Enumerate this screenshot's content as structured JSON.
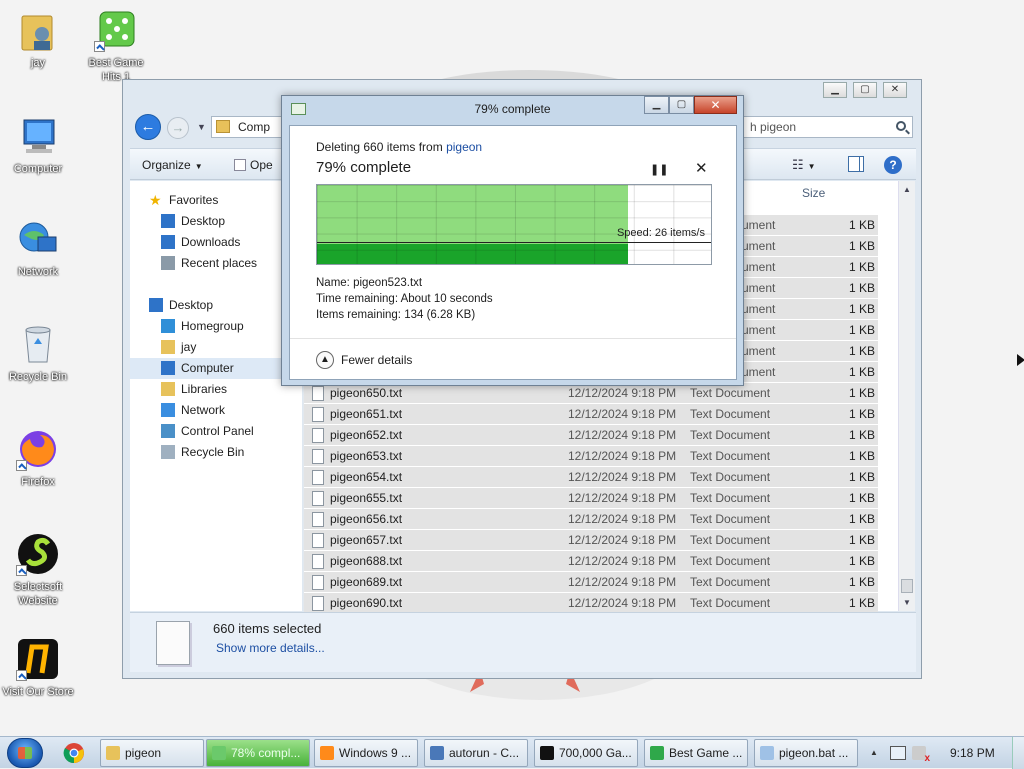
{
  "desktop": {
    "icons": [
      {
        "label": "jay",
        "icon": "user-folder-icon"
      },
      {
        "label": "Best Game Hits 1",
        "icon": "dice-icon"
      },
      {
        "label": "Computer",
        "icon": "computer-icon"
      },
      {
        "label": "Network",
        "icon": "network-icon"
      },
      {
        "label": "Recycle Bin",
        "icon": "recycle-bin-icon"
      },
      {
        "label": "Firefox",
        "icon": "firefox-icon"
      },
      {
        "label": "Selectsoft Website",
        "icon": "selectsoft-icon"
      },
      {
        "label": "Visit Our Store",
        "icon": "store-icon"
      }
    ]
  },
  "explorer": {
    "address_crumb": "Comp",
    "search_placeholder": "h pigeon",
    "toolbar": {
      "organize": "Organize",
      "open": "Ope"
    },
    "nav": [
      {
        "label": "Favorites",
        "icon": "star-icon",
        "level": 0
      },
      {
        "label": "Desktop",
        "icon": "desktop-icon",
        "level": 1
      },
      {
        "label": "Downloads",
        "icon": "downloads-icon",
        "level": 1
      },
      {
        "label": "Recent places",
        "icon": "recent-places-icon",
        "level": 1
      },
      {
        "label": "Desktop",
        "icon": "desktop-icon",
        "level": 0
      },
      {
        "label": "Homegroup",
        "icon": "homegroup-icon",
        "level": 1
      },
      {
        "label": "jay",
        "icon": "user-folder-icon",
        "level": 1
      },
      {
        "label": "Computer",
        "icon": "computer-icon",
        "level": 1,
        "selected": true
      },
      {
        "label": "Libraries",
        "icon": "libraries-icon",
        "level": 1
      },
      {
        "label": "Network",
        "icon": "network-icon",
        "level": 1
      },
      {
        "label": "Control Panel",
        "icon": "control-panel-icon",
        "level": 1
      },
      {
        "label": "Recycle Bin",
        "icon": "recycle-bin-icon",
        "level": 1
      }
    ],
    "columns": {
      "size": "Size"
    },
    "partial_rows": [
      {
        "type": "ument",
        "size": "1 KB"
      },
      {
        "type": "ument",
        "size": "1 KB"
      },
      {
        "type": "ument",
        "size": "1 KB"
      },
      {
        "type": "ument",
        "size": "1 KB"
      },
      {
        "type": "ument",
        "size": "1 KB"
      },
      {
        "type": "ument",
        "size": "1 KB"
      },
      {
        "type": "ument",
        "size": "1 KB"
      },
      {
        "type": "ument",
        "size": "1 KB"
      }
    ],
    "rows": [
      {
        "name": "pigeon650.txt",
        "date": "12/12/2024 9:18 PM",
        "type": "Text Document",
        "size": "1 KB"
      },
      {
        "name": "pigeon651.txt",
        "date": "12/12/2024 9:18 PM",
        "type": "Text Document",
        "size": "1 KB"
      },
      {
        "name": "pigeon652.txt",
        "date": "12/12/2024 9:18 PM",
        "type": "Text Document",
        "size": "1 KB"
      },
      {
        "name": "pigeon653.txt",
        "date": "12/12/2024 9:18 PM",
        "type": "Text Document",
        "size": "1 KB"
      },
      {
        "name": "pigeon654.txt",
        "date": "12/12/2024 9:18 PM",
        "type": "Text Document",
        "size": "1 KB"
      },
      {
        "name": "pigeon655.txt",
        "date": "12/12/2024 9:18 PM",
        "type": "Text Document",
        "size": "1 KB"
      },
      {
        "name": "pigeon656.txt",
        "date": "12/12/2024 9:18 PM",
        "type": "Text Document",
        "size": "1 KB"
      },
      {
        "name": "pigeon657.txt",
        "date": "12/12/2024 9:18 PM",
        "type": "Text Document",
        "size": "1 KB"
      },
      {
        "name": "pigeon688.txt",
        "date": "12/12/2024 9:18 PM",
        "type": "Text Document",
        "size": "1 KB"
      },
      {
        "name": "pigeon689.txt",
        "date": "12/12/2024 9:18 PM",
        "type": "Text Document",
        "size": "1 KB"
      },
      {
        "name": "pigeon690.txt",
        "date": "12/12/2024 9:18 PM",
        "type": "Text Document",
        "size": "1 KB"
      }
    ],
    "details": {
      "selected": "660 items selected",
      "more": "Show more details..."
    }
  },
  "dialog": {
    "title": "79% complete",
    "deleting_prefix": "Deleting 660 items from ",
    "source_folder": "pigeon",
    "percent_text": "79% complete",
    "progress": 0.79,
    "speed": "Speed: 26 items/s",
    "name_line": "Name:  pigeon523.txt",
    "time_line": "Time remaining:  About 10 seconds",
    "items_line": "Items remaining:  134 (6.28 KB)",
    "fewer_details": "Fewer details",
    "accent_light": "#8fdc7e",
    "accent_dark": "#1aa42a"
  },
  "taskbar": {
    "tasks": [
      {
        "label": "pigeon",
        "icon": "folder-icon",
        "active": false
      },
      {
        "label": "78% compl...",
        "icon": "copy-progress-icon",
        "active": true
      },
      {
        "label": "Windows 9 ...",
        "icon": "firefox-icon",
        "active": false
      },
      {
        "label": "autorun - C...",
        "icon": "autorun-icon",
        "active": false
      },
      {
        "label": "700,000 Ga...",
        "icon": "selectsoft-icon",
        "active": false
      },
      {
        "label": "Best Game ...",
        "icon": "best-game-icon",
        "active": false
      },
      {
        "label": "pigeon.bat ...",
        "icon": "notepad-icon",
        "active": false
      }
    ],
    "clock": "9:18 PM"
  }
}
